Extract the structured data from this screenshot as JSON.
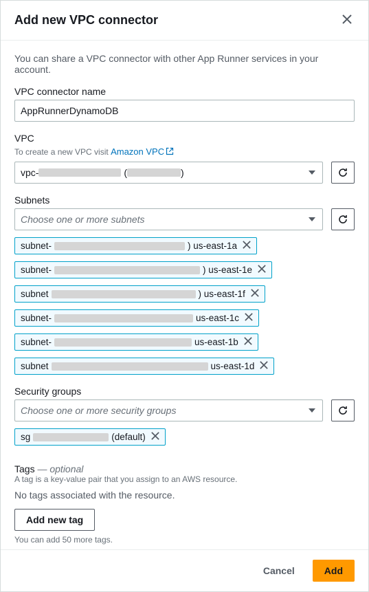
{
  "modal": {
    "title": "Add new VPC connector",
    "description": "You can share a VPC connector with other App Runner services in your account."
  },
  "connector_name": {
    "label": "VPC connector name",
    "value": "AppRunnerDynamoDB"
  },
  "vpc": {
    "label": "VPC",
    "helper_prefix": "To create a new VPC visit ",
    "helper_link": "Amazon VPC",
    "selected_prefix": "vpc-"
  },
  "subnets": {
    "label": "Subnets",
    "placeholder": "Choose one or more subnets",
    "items": [
      {
        "prefix": "subnet-",
        "az": ") us-east-1a",
        "redact_w": 190
      },
      {
        "prefix": "subnet-",
        "az": ") us-east-1e",
        "redact_w": 212
      },
      {
        "prefix": "subnet ",
        "az": ") us-east-1f",
        "redact_w": 210
      },
      {
        "prefix": "subnet-",
        "az": "us-east-1c",
        "redact_w": 202
      },
      {
        "prefix": "subnet-",
        "az": "us-east-1b",
        "redact_w": 200
      },
      {
        "prefix": "subnet ",
        "az": "us-east-1d",
        "redact_w": 228
      }
    ]
  },
  "security_groups": {
    "label": "Security groups",
    "placeholder": "Choose one or more security groups",
    "items": [
      {
        "prefix": "sg",
        "suffix": "(default)",
        "redact_w": 110
      }
    ]
  },
  "tags": {
    "heading": "Tags",
    "optional": "— optional",
    "desc": "A tag is a key-value pair that you assign to an AWS resource.",
    "none": "No tags associated with the resource.",
    "add_button": "Add new tag",
    "limit_hint": "You can add 50 more tags."
  },
  "footer": {
    "cancel": "Cancel",
    "add": "Add"
  }
}
